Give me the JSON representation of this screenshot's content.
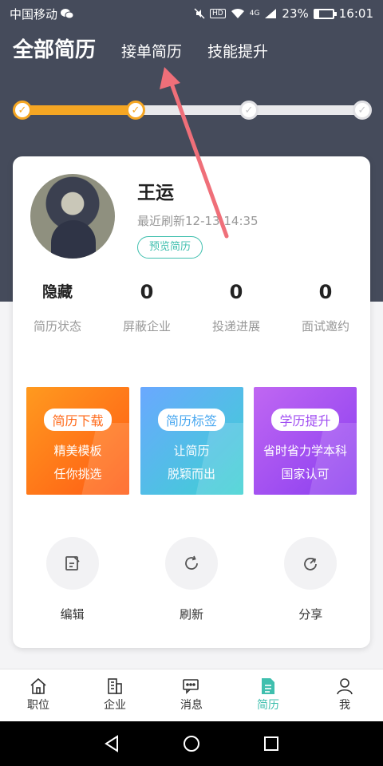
{
  "status_bar": {
    "carrier": "中国移动",
    "hd": "HD",
    "network": "4G",
    "battery": "23%",
    "battery_level": 0.23,
    "time": "16:01"
  },
  "tabs": [
    {
      "label": "全部简历",
      "active": true
    },
    {
      "label": "接单简历",
      "active": false
    },
    {
      "label": "技能提升",
      "active": false
    }
  ],
  "progress": {
    "completed_steps": 2,
    "total_steps": 4
  },
  "profile": {
    "name": "王运",
    "refresh_time": "最近刷新12-13 14:35",
    "preview_button": "预览简历"
  },
  "stats": [
    {
      "value": "隐藏",
      "label": "简历状态"
    },
    {
      "value": "0",
      "label": "屏蔽企业"
    },
    {
      "value": "0",
      "label": "投递进展"
    },
    {
      "value": "0",
      "label": "面试邀约"
    }
  ],
  "promos": [
    {
      "tag": "简历下载",
      "line1": "精美模板",
      "line2": "任你挑选"
    },
    {
      "tag": "简历标签",
      "line1": "让简历",
      "line2": "脱颖而出"
    },
    {
      "tag": "学历提升",
      "line1": "省时省力学本科",
      "line2": "国家认可"
    }
  ],
  "actions": [
    {
      "label": "编辑",
      "icon": "edit-icon"
    },
    {
      "label": "刷新",
      "icon": "refresh-icon"
    },
    {
      "label": "分享",
      "icon": "share-icon"
    }
  ],
  "bottom_nav": [
    {
      "label": "职位",
      "icon": "home-icon"
    },
    {
      "label": "企业",
      "icon": "building-icon"
    },
    {
      "label": "消息",
      "icon": "message-icon"
    },
    {
      "label": "简历",
      "icon": "resume-icon",
      "active": true
    },
    {
      "label": "我",
      "icon": "user-icon"
    }
  ],
  "colors": {
    "header_bg": "#454b5b",
    "accent_orange": "#f5a623",
    "accent_teal": "#3fbfae",
    "annotation_arrow": "#ef6f79"
  }
}
